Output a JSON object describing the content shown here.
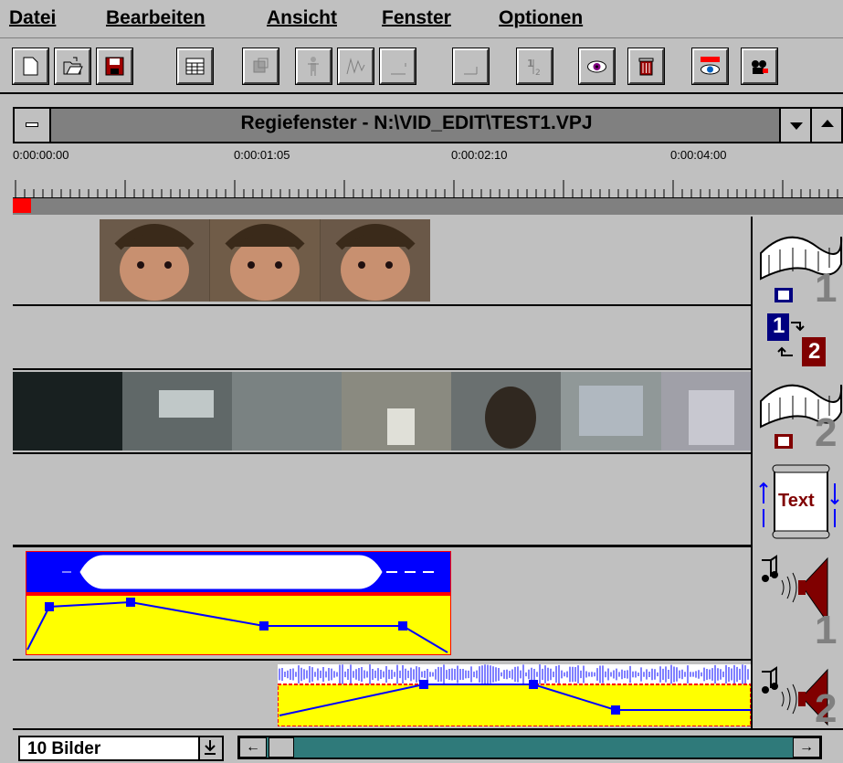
{
  "menu": {
    "items": [
      "Datei",
      "Bearbeiten",
      "Ansicht",
      "Fenster",
      "Optionen"
    ]
  },
  "toolbar": {
    "buttons": [
      "new-file-icon",
      "open-folder-icon",
      "save-disk-icon",
      "grid-icon",
      "transition-icon",
      "figure-icon",
      "wave-icon",
      "marker-icon",
      "corner-icon",
      "split-icon",
      "preview-eye-icon",
      "trash-icon",
      "eye-film-icon",
      "camera-icon"
    ]
  },
  "window": {
    "title": "Regiefenster - N:\\VID_EDIT\\TEST1.VPJ"
  },
  "ruler": {
    "timecodes": [
      "0:00:00:00",
      "0:00:01:05",
      "0:00:02:10",
      "0:00:04:00"
    ]
  },
  "tracks": {
    "video1_label": "1",
    "transition_a": "1",
    "transition_b": "2",
    "video2_label": "2",
    "text_label": "Text",
    "audio1_label": "1",
    "audio2_label": "2"
  },
  "status": {
    "zoom": "10 Bilder"
  },
  "colors": {
    "window_bg": "#c0c0c0",
    "title_bar": "#808080",
    "playhead": "#ff0000",
    "audio_wave_bg": "#0000ff",
    "volume_bg": "#ffff00",
    "scrollbar": "#2f7a7a"
  }
}
